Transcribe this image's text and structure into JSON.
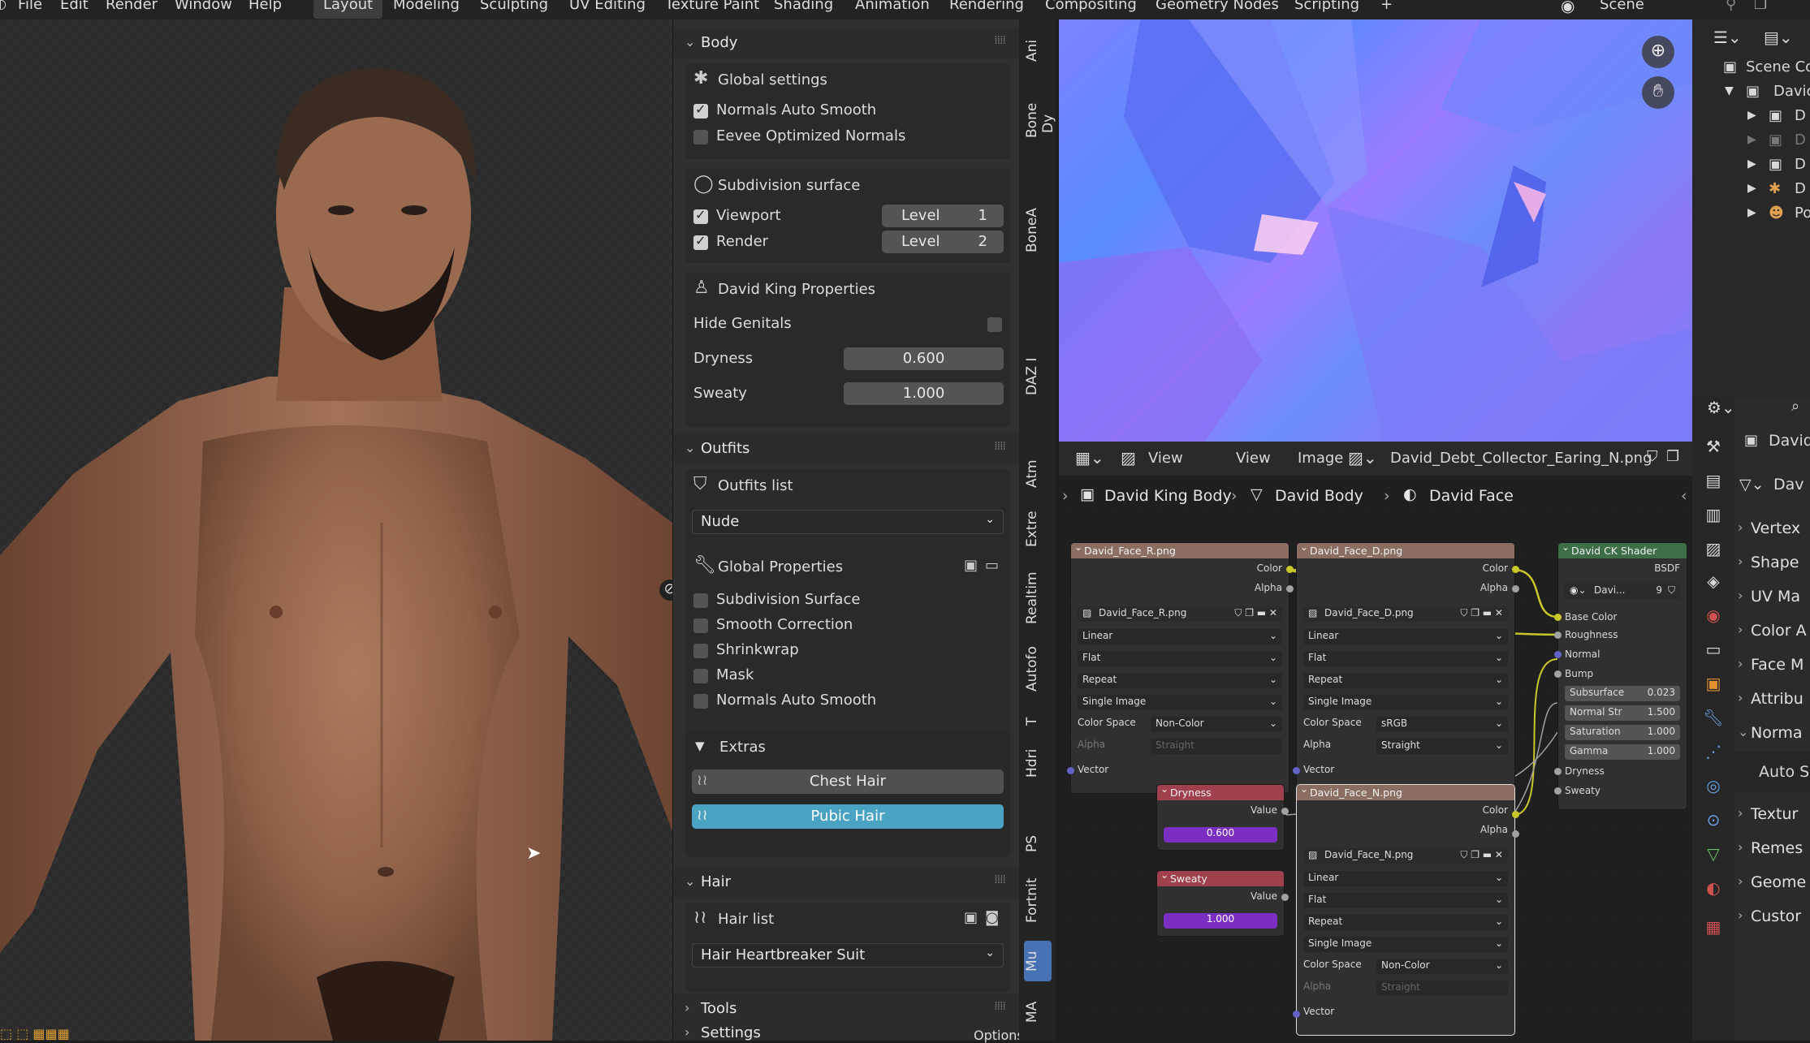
{
  "menu": [
    "File",
    "Edit",
    "Render",
    "Window",
    "Help"
  ],
  "workspaces": [
    "Layout",
    "Modeling",
    "Sculpting",
    "UV Editing",
    "Texture Paint",
    "Shading",
    "Animation",
    "Rendering",
    "Compositing",
    "Geometry Nodes",
    "Scripting"
  ],
  "active_workspace": "Layout",
  "add_tab": "+",
  "scene_label": "Scene",
  "panel": {
    "body": {
      "header": "Body",
      "global_settings": "Global settings",
      "normals_auto_smooth": "Normals Auto Smooth",
      "eevee_optimized_normals": "Eevee Optimized Normals",
      "subdivision_surface": "Subdivision surface",
      "viewport": "Viewport",
      "render": "Render",
      "level_label": "Level",
      "viewport_level": "1",
      "render_level": "2",
      "david_props": "David King Properties",
      "hide_genitals": "Hide Genitals",
      "dryness_label": "Dryness",
      "dryness_value": "0.600",
      "sweaty_label": "Sweaty",
      "sweaty_value": "1.000"
    },
    "outfits": {
      "header": "Outfits",
      "list_label": "Outfits list",
      "selected": "Nude",
      "global_props": "Global Properties",
      "subdivision_surface": "Subdivision Surface",
      "smooth_correction": "Smooth Correction",
      "shrinkwrap": "Shrinkwrap",
      "mask": "Mask",
      "normals_auto_smooth": "Normals Auto Smooth",
      "extras": "Extras",
      "chest_hair": "Chest Hair",
      "pubic_hair": "Pubic Hair"
    },
    "hair": {
      "header": "Hair",
      "list_label": "Hair list",
      "selected": "Hair Heartbreaker Suit"
    },
    "tools_header": "Tools",
    "settings_header": "Settings",
    "options_label": "Options"
  },
  "vertical_tabs": [
    "Ani",
    "Bone Dy",
    "BoneA",
    "DAZ I",
    "Atm",
    "Extre",
    "Realtim",
    "Autofo",
    "T",
    "Hdri",
    "PS",
    "Fortnit",
    "Mu",
    "MA"
  ],
  "active_vtab": "Mu",
  "image_editor": {
    "view": "View",
    "view2": "View",
    "image": "Image",
    "image_name": "David_Debt_Collector_Earing_N.png"
  },
  "node_editor": {
    "breadcrumb": [
      "David King Body",
      "David Body",
      "David Face"
    ],
    "nodes": {
      "face_r": {
        "title": "David_Face_R.png",
        "color": "Color",
        "alpha": "Alpha",
        "file": "David_Face_R.png",
        "interp": "Linear",
        "proj": "Flat",
        "ext": "Repeat",
        "src": "Single Image",
        "cs_label": "Color Space",
        "cs": "Non-Color",
        "alpha_label": "Alpha",
        "alpha_mode": "Straight",
        "vector": "Vector"
      },
      "face_d": {
        "title": "David_Face_D.png",
        "color": "Color",
        "alpha": "Alpha",
        "file": "David_Face_D.png",
        "interp": "Linear",
        "proj": "Flat",
        "ext": "Repeat",
        "src": "Single Image",
        "cs_label": "Color Space",
        "cs": "sRGB",
        "alpha_label": "Alpha",
        "alpha_mode": "Straight",
        "vector": "Vector"
      },
      "face_n": {
        "title": "David_Face_N.png",
        "color": "Color",
        "alpha": "Alpha",
        "file": "David_Face_N.png",
        "interp": "Linear",
        "proj": "Flat",
        "ext": "Repeat",
        "src": "Single Image",
        "cs_label": "Color Space",
        "cs": "Non-Color",
        "alpha_label": "Alpha",
        "alpha_mode": "Straight",
        "vector": "Vector"
      },
      "dryness": {
        "title": "Dryness",
        "value_label": "Value",
        "value": "0.600"
      },
      "sweaty": {
        "title": "Sweaty",
        "value_label": "Value",
        "value": "1.000"
      },
      "shader": {
        "title": "David CK Shader",
        "bsdf": "BSDF",
        "group": "Davi...",
        "users": "9",
        "base_color": "Base Color",
        "roughness": "Roughness",
        "normal": "Normal",
        "bump": "Bump",
        "subsurface": "Subsurface",
        "subsurface_v": "0.023",
        "normal_str": "Normal Str",
        "normal_str_v": "1.500",
        "saturation": "Saturation",
        "saturation_v": "1.000",
        "gamma": "Gamma",
        "gamma_v": "1.000",
        "dryness": "Dryness",
        "sweaty": "Sweaty"
      }
    }
  },
  "outliner": {
    "scene": "Scene Co",
    "items": [
      "Davic",
      "D",
      "D",
      "D",
      "D",
      "Po"
    ]
  },
  "properties": {
    "object": "David",
    "mesh": "Dav",
    "items": [
      "Vertex",
      "Shape",
      "UV Ma",
      "Color A",
      "Face M",
      "Attribu",
      "Norma",
      "Auto Sm",
      "Textur",
      "Remes",
      "Geome",
      "Custor"
    ]
  },
  "colors": {
    "accent": "#4772b3",
    "pubic_hair_active": "#4aa3c3",
    "value_purple": "#7a2fc2",
    "image_node_header": "#8b6e63",
    "value_node_header": "#a0404e",
    "group_node_header": "#3d6e47"
  }
}
